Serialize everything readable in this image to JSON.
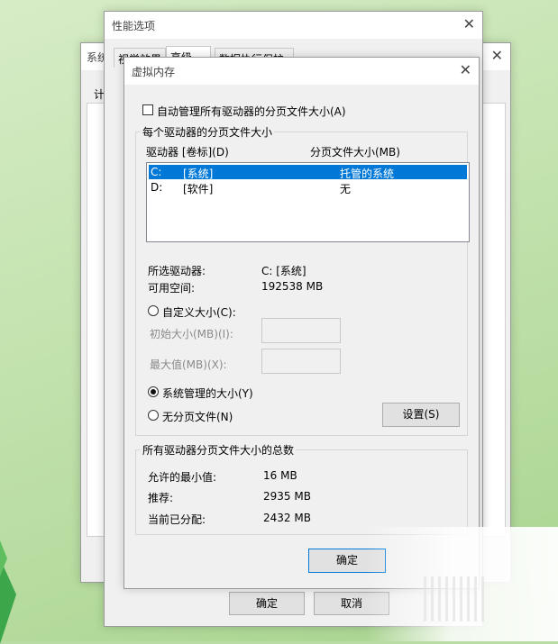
{
  "sys_dialog": {
    "title": "系统",
    "tab_fragment": "计"
  },
  "perf_dialog": {
    "title": "性能选项",
    "tabs": [
      "视觉效果",
      "高级",
      "数据执行保护"
    ],
    "ok_label": "确定",
    "cancel_label": "取消"
  },
  "vm_dialog": {
    "title": "虚拟内存",
    "auto_manage_label": "自动管理所有驱动器的分页文件大小(A)",
    "per_drive_group": "每个驱动器的分页文件大小",
    "col_drive": "驱动器 [卷标](D)",
    "col_size": "分页文件大小(MB)",
    "drives": [
      {
        "letter": "C:",
        "label": "[系统]",
        "size": "托管的系统"
      },
      {
        "letter": "D:",
        "label": "[软件]",
        "size": "无"
      }
    ],
    "selected_drive_label": "所选驱动器:",
    "selected_drive_value": "C:  [系统]",
    "free_space_label": "可用空间:",
    "free_space_value": "192538 MB",
    "custom_size_label": "自定义大小(C):",
    "initial_size_label": "初始大小(MB)(I):",
    "max_size_label": "最大值(MB)(X):",
    "system_managed_label": "系统管理的大小(Y)",
    "no_paging_label": "无分页文件(N)",
    "set_button": "设置(S)",
    "totals_group": "所有驱动器分页文件大小的总数",
    "min_allowed_label": "允许的最小值:",
    "min_allowed_value": "16 MB",
    "recommended_label": "推荐:",
    "recommended_value": "2935 MB",
    "current_label": "当前已分配:",
    "current_value": "2432 MB",
    "ok_label": "确定"
  },
  "icons": {
    "close": "close-icon"
  }
}
